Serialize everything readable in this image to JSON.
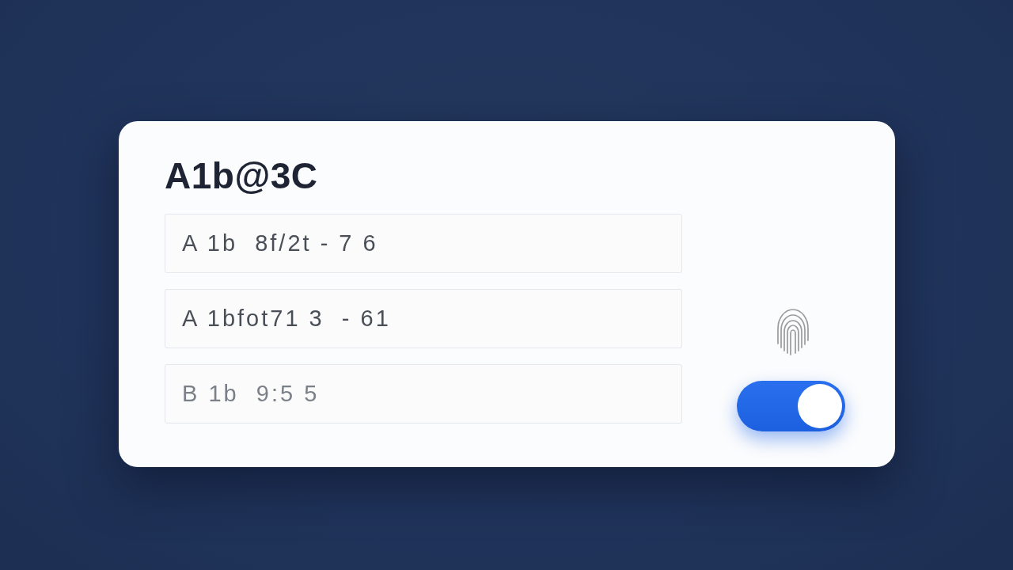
{
  "card": {
    "title": "A1b@3C",
    "fields": [
      {
        "value": "A 1b  8f/2t - 7 6"
      },
      {
        "value": "A 1bfot71 3  - 61"
      },
      {
        "placeholder": "B 1b  9:5 5"
      }
    ],
    "toggle": {
      "on": true
    }
  }
}
